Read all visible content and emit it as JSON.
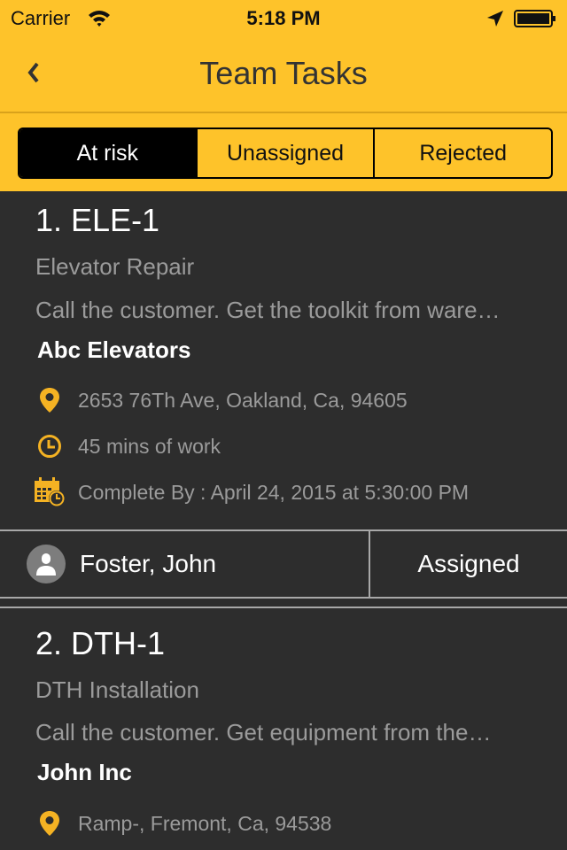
{
  "status_bar": {
    "carrier": "Carrier",
    "time": "5:18 PM",
    "icons": [
      "wifi-icon",
      "location-arrow-icon",
      "battery-icon"
    ]
  },
  "nav": {
    "title": "Team Tasks",
    "back_icon": "chevron-left-icon"
  },
  "segments": [
    {
      "label": "At risk",
      "selected": true
    },
    {
      "label": "Unassigned",
      "selected": false
    },
    {
      "label": "Rejected",
      "selected": false
    }
  ],
  "colors": {
    "accent": "#fec32a",
    "background": "#2d2d2d",
    "secondary_text": "#9b9b9b",
    "divider": "#a8a8a8"
  },
  "tasks": [
    {
      "id": "1. ELE-1",
      "type": "Elevator Repair",
      "description": "Call the customer. Get the toolkit from ware…",
      "company": "Abc Elevators",
      "address": "2653 76Th Ave, Oakland, Ca, 94605",
      "duration": "45 mins of work",
      "complete_by": "Complete By : April 24, 2015 at 5:30:00 PM",
      "assignee": "Foster, John",
      "status": "Assigned"
    },
    {
      "id": "2. DTH-1",
      "type": "DTH Installation",
      "description": "Call the customer. Get equipment from the…",
      "company": "John Inc",
      "address": "Ramp-, Fremont, Ca, 94538"
    }
  ]
}
